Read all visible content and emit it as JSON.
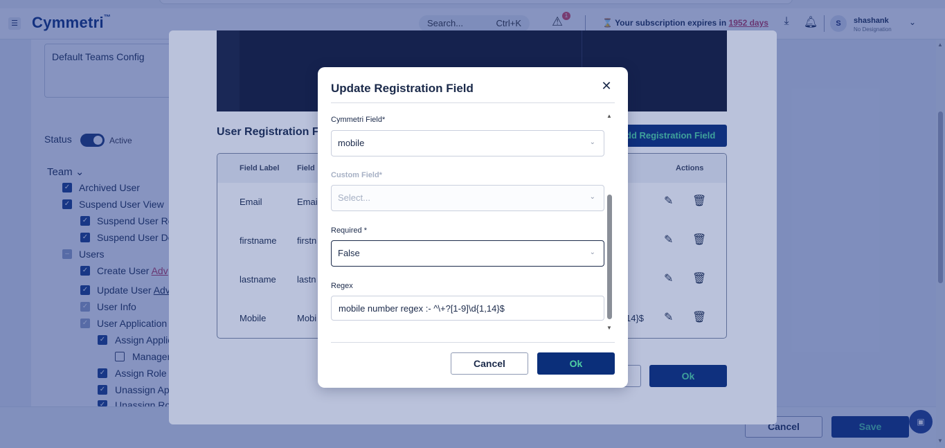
{
  "header": {
    "logo": "Cymmetri",
    "logo_tm": "™",
    "search_placeholder": "Search...",
    "search_shortcut": "Ctrl+K",
    "alert_count": "1",
    "subscription_prefix": "Your subscription expires in ",
    "subscription_days": "1952 days",
    "user_name": "shashank",
    "user_designation": "No Designation",
    "avatar_initial": "S"
  },
  "page": {
    "config_name": "Default Teams Config",
    "status_label": "Status",
    "status_value": "Active",
    "team_label": "Team",
    "tree": [
      {
        "label": "Archived User"
      },
      {
        "label": "Suspend User View"
      },
      {
        "label": "Suspend User Re"
      },
      {
        "label": "Suspend User De"
      },
      {
        "label": "Users"
      },
      {
        "label": "Create User",
        "link": "Adv"
      },
      {
        "label": "Update User",
        "link": "Adv"
      },
      {
        "label": "User Info"
      },
      {
        "label": "User Application"
      },
      {
        "label": "Assign Applic"
      },
      {
        "label": "Manager"
      },
      {
        "label": "Assign Role"
      },
      {
        "label": "Unassign App"
      },
      {
        "label": "Unassign Rol"
      }
    ],
    "cancel_label": "Cancel",
    "save_label": "Save"
  },
  "registration_modal": {
    "title": "User Registration F",
    "add_button": "dd Registration Field",
    "columns": [
      "Field Label",
      "Field",
      "Actions"
    ],
    "rows": [
      {
        "label": "Email",
        "field": "Emai"
      },
      {
        "label": "firstname",
        "field": "firstn"
      },
      {
        "label": "lastname",
        "field": "lastn"
      },
      {
        "label": "Mobile",
        "field": "Mobi",
        "regex_tail": "14}$"
      }
    ],
    "ok_label": "Ok"
  },
  "dialog": {
    "title": "Update Registration Field",
    "cymmetri_field_label": "Cymmetri Field*",
    "cymmetri_field_value": "mobile",
    "custom_field_label": "Custom Field*",
    "custom_field_placeholder": "Select...",
    "required_label": "Required *",
    "required_value": "False",
    "regex_label": "Regex",
    "regex_value": "mobile number regex :- ^\\+?[1-9]\\d{1,14}$",
    "cancel_label": "Cancel",
    "ok_label": "Ok"
  }
}
